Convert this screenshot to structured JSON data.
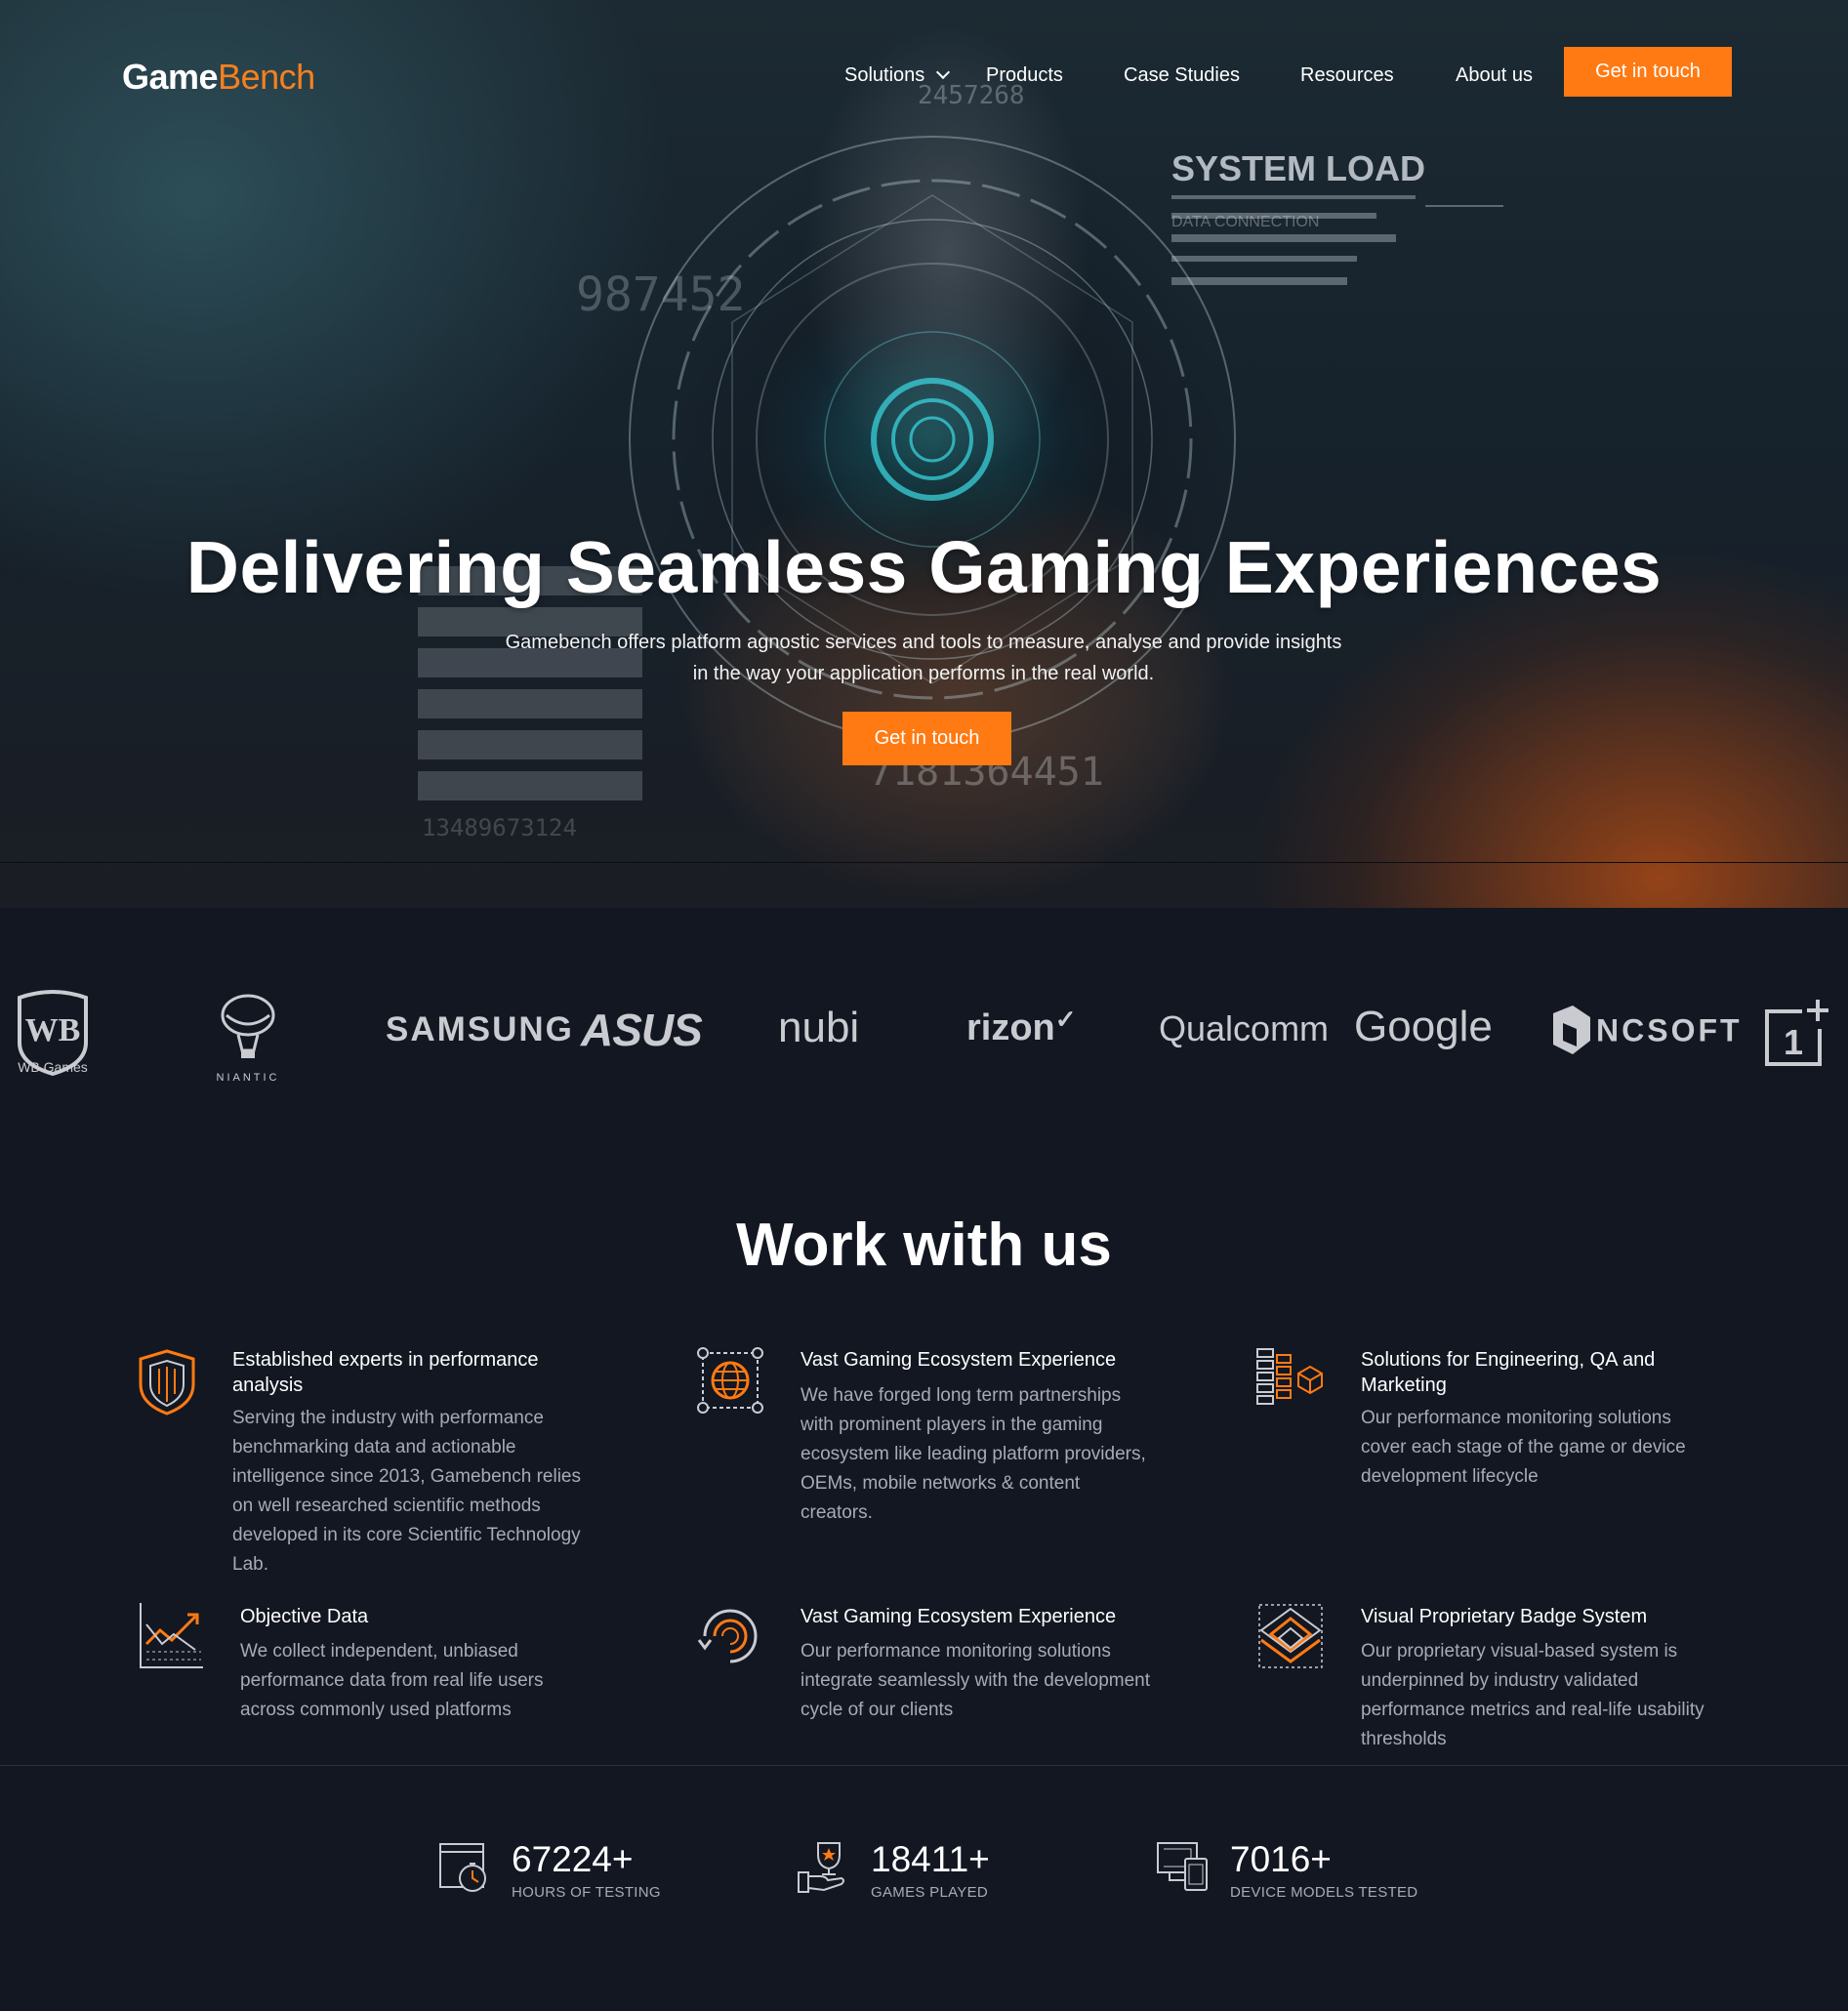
{
  "brand": {
    "name_part1": "Game",
    "name_part2": "Bench",
    "accent_color": "#ff7a12"
  },
  "nav": {
    "items": [
      {
        "label": "Solutions",
        "has_dropdown": true
      },
      {
        "label": "Products"
      },
      {
        "label": "Case Studies"
      },
      {
        "label": "Resources"
      },
      {
        "label": "About us"
      }
    ],
    "cta_label": "Get in touch"
  },
  "hero": {
    "title": "Delivering Seamless Gaming Experiences",
    "subtitle_line1": "Gamebench offers platform agnostic services and tools to measure, analyse and provide insights",
    "subtitle_line2": "in the way your application performs in the real world.",
    "cta_label": "Get in touch",
    "hud": {
      "system_load": "SYSTEM LOAD",
      "data_connection": "DATA CONNECTION",
      "num_left": "987452",
      "num_top": "2457268",
      "num_bottom": "7181364451",
      "num_panel": "13489673124"
    }
  },
  "partners": [
    {
      "name": "WB Games",
      "icon": "wb-games-shield"
    },
    {
      "name": "NIANTIC",
      "icon": "niantic-balloon"
    },
    {
      "name": "SAMSUNG"
    },
    {
      "name": "ASUS"
    },
    {
      "name": "nubi"
    },
    {
      "name": "rizon"
    },
    {
      "name": "Qualcomm"
    },
    {
      "name": "Google"
    },
    {
      "name": "NCSOFT"
    },
    {
      "name": "1+",
      "icon": "oneplus-logo"
    }
  ],
  "work": {
    "title": "Work with us",
    "features": [
      {
        "icon": "shield-icon",
        "title": "Established experts in performance analysis",
        "text": "Serving the industry with performance benchmarking data and actionable intelligence since 2013, Gamebench relies on well researched scientific methods developed in its core Scientific Technology Lab."
      },
      {
        "icon": "globe-icon",
        "title": "Vast Gaming Ecosystem Experience",
        "text": "We have forged long term partnerships with prominent players in the gaming ecosystem like leading platform providers, OEMs, mobile networks & content creators."
      },
      {
        "icon": "server-stack-icon",
        "title": "Solutions for Engineering, QA and Marketing",
        "text": "Our performance monitoring solutions cover each stage of the game or device development lifecycle"
      },
      {
        "icon": "line-chart-icon",
        "title": "Objective Data",
        "text": "We collect independent, unbiased performance data from real life users across commonly used platforms"
      },
      {
        "icon": "circular-arrows-icon",
        "title": "Vast Gaming Ecosystem Experience",
        "text": "Our performance monitoring solutions integrate seamlessly with the development cycle of our clients"
      },
      {
        "icon": "layered-diamond-icon",
        "title": "Visual Proprietary Badge System",
        "text": "Our proprietary visual-based system is underpinned by industry validated performance metrics and real-life usability thresholds"
      }
    ]
  },
  "stats": [
    {
      "icon": "stopwatch-icon",
      "value": "67224+",
      "label": "HOURS OF TESTING"
    },
    {
      "icon": "trophy-hand-icon",
      "value": "18411+",
      "label": "GAMES PLAYED"
    },
    {
      "icon": "devices-icon",
      "value": "7016+",
      "label": "DEVICE MODELS TESTED"
    }
  ]
}
